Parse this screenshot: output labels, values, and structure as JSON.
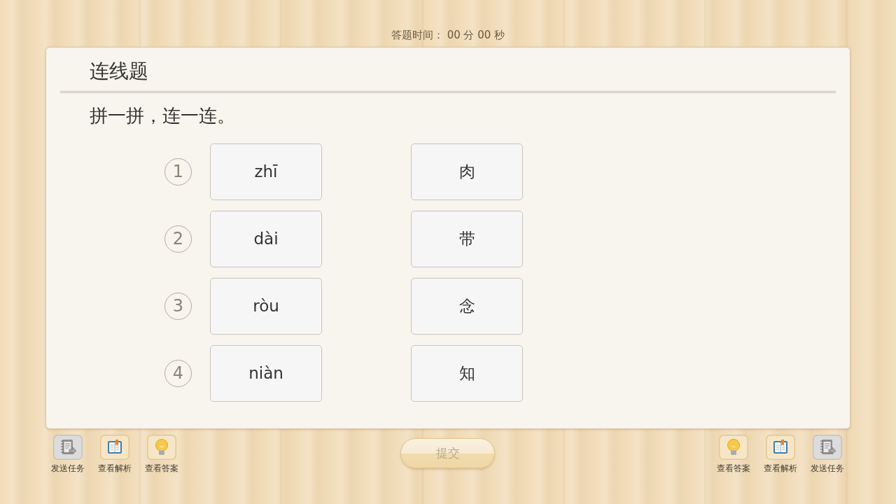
{
  "timer": "答题时间： 00 分 00 秒",
  "question": {
    "type_title": "连线题",
    "prompt": "拼一拼，连一连。",
    "rows": [
      {
        "number": "1",
        "pinyin": "zhī",
        "character": "肉"
      },
      {
        "number": "2",
        "pinyin": "dài",
        "character": "带"
      },
      {
        "number": "3",
        "pinyin": "ròu",
        "character": "念"
      },
      {
        "number": "4",
        "pinyin": "niàn",
        "character": "知"
      }
    ]
  },
  "left_tools": [
    {
      "kind": "send",
      "label": "发送任务"
    },
    {
      "kind": "analysis",
      "label": "查看解析"
    },
    {
      "kind": "answer",
      "label": "查看答案"
    }
  ],
  "submit": {
    "label": "提交",
    "disabled": true
  },
  "right_tools": [
    {
      "kind": "answer",
      "label": "查看答案"
    },
    {
      "kind": "analysis",
      "label": "查看解析"
    },
    {
      "kind": "send",
      "label": "发送任务"
    }
  ]
}
